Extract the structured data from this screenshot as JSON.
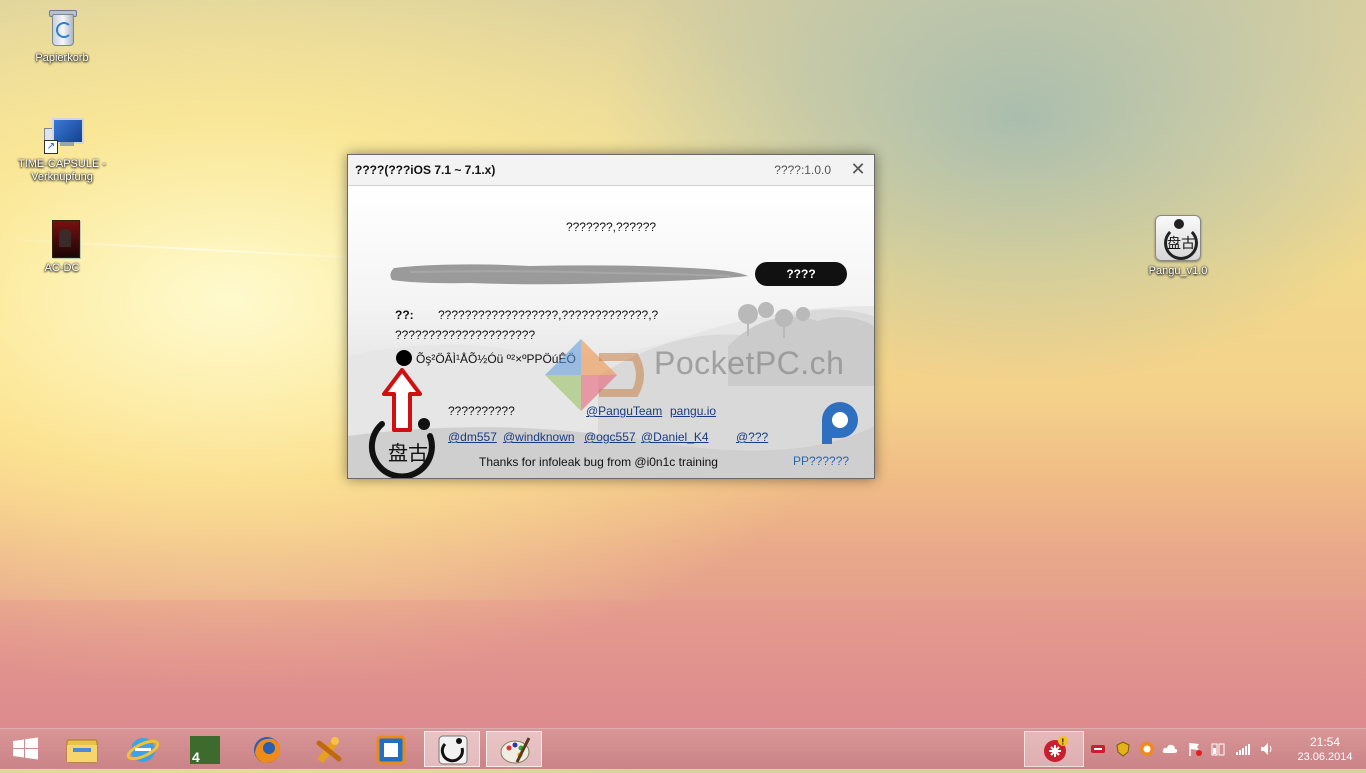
{
  "desktop": {
    "icons": [
      {
        "label": "Papierkorb",
        "icon": "recycle-bin-icon"
      },
      {
        "label": "TIME-CAPSULE - Verknüpfung",
        "label_line1": "TIME-CAPSULE -",
        "label_line2": "Verknüpfung",
        "icon": "network-drive-shortcut-icon"
      },
      {
        "label": "AC-DC",
        "icon": "game-cover-icon"
      },
      {
        "label": "Pangu_v1.0",
        "icon": "pangu-app-icon"
      }
    ]
  },
  "dialog": {
    "title": "????(???iOS 7.1 ~ 7.1.x)",
    "version": "????:1.0.0",
    "subtitle": "???????,??????",
    "start_button": "????",
    "info_label": "??:",
    "info_line1": "??????????????????,?????????????,?",
    "info_line2": "?????????????????????",
    "garbled_text": "Õş²ÖÂÌ¹ÅÕ½Óü º²×ºPPÖúÊÖ",
    "team_label": "??????????",
    "links": {
      "pangu_team": "@PanguTeam",
      "pangu_io": "pangu.io",
      "dm557": "@dm557",
      "windknown": "@windknown",
      "ogc557": "@ogc557",
      "daniel": "@Daniel_K4",
      "unknown": "@???"
    },
    "thanks": "Thanks for infoleak bug from @i0n1c training",
    "pp_label": "PP??????"
  },
  "watermark": {
    "text": "PocketPC.ch"
  },
  "taskbar": {
    "items": [
      {
        "icon": "windows-start-icon"
      },
      {
        "icon": "file-explorer-icon"
      },
      {
        "icon": "internet-explorer-icon"
      },
      {
        "icon": "game-4-icon"
      },
      {
        "icon": "firefox-icon"
      },
      {
        "icon": "tools-icon"
      },
      {
        "icon": "virtualbox-icon"
      },
      {
        "icon": "pangu-icon",
        "active": true
      },
      {
        "icon": "paint-icon",
        "active": true
      }
    ],
    "clock": {
      "time": "21:54",
      "date": "23.06.2014"
    }
  }
}
